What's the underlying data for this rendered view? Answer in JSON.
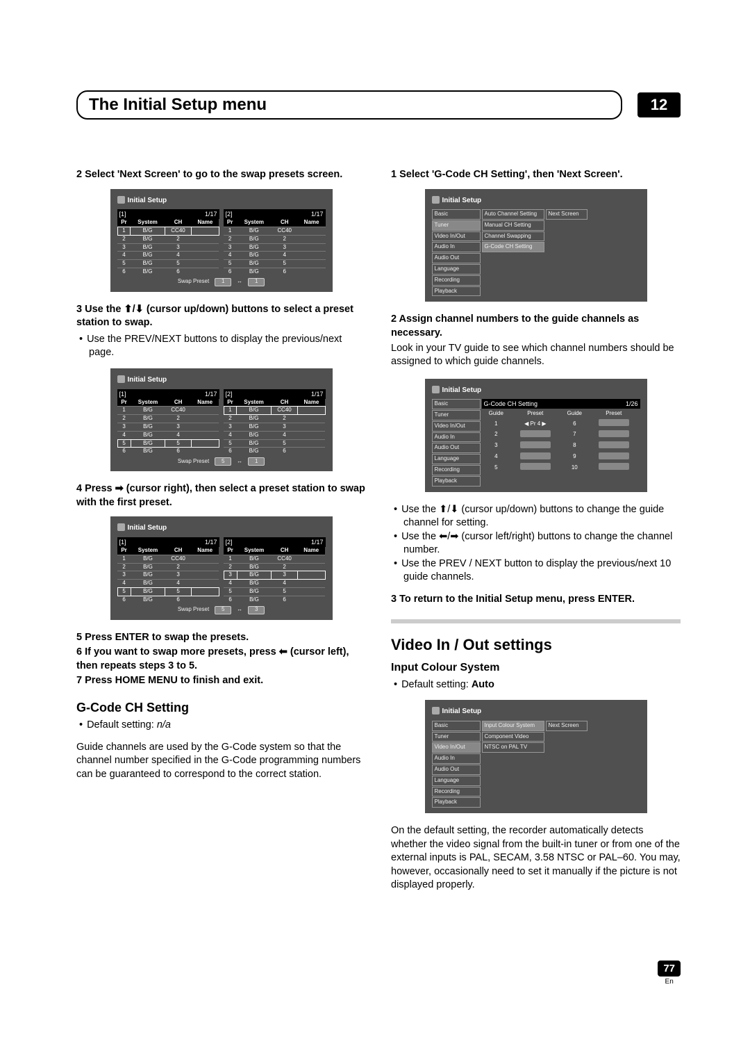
{
  "header": {
    "title": "The Initial Setup menu",
    "chapter": "12"
  },
  "left": {
    "step2": "2   Select 'Next Screen' to go to the swap presets screen.",
    "step3": "3   Use the ⬆/⬇ (cursor up/down) buttons to select a preset station to swap.",
    "step3_bul": "Use the PREV/NEXT buttons to display the previous/next page.",
    "step4": "4   Press ➡ (cursor right), then select a preset station to swap with the first preset.",
    "step5": "5   Press ENTER to swap the presets.",
    "step6": "6   If you want to swap more presets, press ⬅ (cursor left), then repeats steps 3 to 5.",
    "step7": "7   Press HOME MENU to finish and exit.",
    "gcode_h": "G-Code CH Setting",
    "gcode_def": "Default setting: n/a",
    "gcode_body": "Guide channels are used by the G-Code system so that the channel number specified in the G-Code programming numbers can be guaranteed to correspond to the correct station."
  },
  "right": {
    "step1": "1   Select 'G-Code CH Setting', then 'Next Screen'.",
    "step2": "2   Assign channel numbers to the guide channels as necessary.",
    "step2_body": "Look in your TV guide to see which channel numbers should be assigned to which guide channels.",
    "bul1": "Use the ⬆/⬇ (cursor up/down) buttons to change the guide channel for setting.",
    "bul2": "Use the ⬅/➡ (cursor left/right) buttons to change the channel number.",
    "bul3": "Use the PREV / NEXT button to display the previous/next 10 guide channels.",
    "step3": "3   To return to the Initial Setup menu, press ENTER.",
    "section": "Video In / Out settings",
    "ics_h": "Input Colour System",
    "ics_def": "Default setting: Auto",
    "ics_body": "On the default setting, the recorder automatically detects whether the video signal from the built-in tuner or from one of the external inputs is PAL, SECAM, 3.58 NTSC or PAL–60. You may, however, occasionally need to set it manually if the picture is not displayed properly."
  },
  "osd": {
    "title": "Initial Setup",
    "swap_label": "Swap Preset",
    "nav": [
      "Basic",
      "Tuner",
      "Video In/Out",
      "Audio In",
      "Audio Out",
      "Language",
      "Recording",
      "Playback"
    ],
    "tuner_sub": [
      "Auto Channel Setting",
      "Manual CH Setting",
      "Channel Swapping",
      "G-Code CH Setting"
    ],
    "video_sub": [
      "Input Colour System",
      "Component Video",
      "NTSC on PAL TV"
    ],
    "next_screen": "Next Screen",
    "gcode_title": "G-Code CH Setting",
    "gcode_page": "1/26",
    "gcode_headers": [
      "Guide",
      "Preset",
      "Guide",
      "Preset"
    ],
    "gcode_left_nums": [
      "1",
      "2",
      "3",
      "4",
      "5"
    ],
    "gcode_right_nums": [
      "6",
      "7",
      "8",
      "9",
      "10"
    ],
    "gcode_pr": "Pr 4",
    "preset_headers": [
      "Pr",
      "System",
      "CH",
      "Name"
    ],
    "page_ind": "1/17",
    "tab1": "[1]",
    "tab2": "[2]",
    "preset_rows": [
      {
        "pr": "1",
        "sys": "B/G",
        "ch": "CC40",
        "name": ""
      },
      {
        "pr": "2",
        "sys": "B/G",
        "ch": "2",
        "name": ""
      },
      {
        "pr": "3",
        "sys": "B/G",
        "ch": "3",
        "name": ""
      },
      {
        "pr": "4",
        "sys": "B/G",
        "ch": "4",
        "name": ""
      },
      {
        "pr": "5",
        "sys": "B/G",
        "ch": "5",
        "name": ""
      },
      {
        "pr": "6",
        "sys": "B/G",
        "ch": "6",
        "name": ""
      }
    ],
    "pgA": {
      "l": "1",
      "r": "1"
    },
    "pgB": {
      "l": "5",
      "r": "1"
    },
    "pgC": {
      "l": "5",
      "r": "3"
    }
  },
  "footer": {
    "page": "77",
    "lang": "En"
  }
}
